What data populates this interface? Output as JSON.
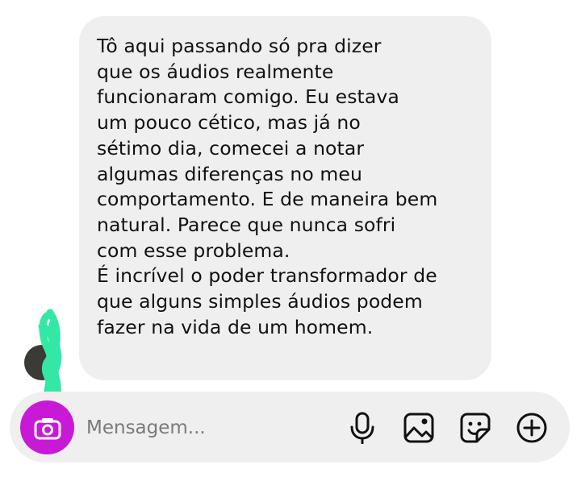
{
  "message": {
    "text": "Tô aqui passando só pra dizer\nque os áudios realmente\nfuncionaram comigo. Eu estava\num pouco cético, mas já no\nsétimo dia, comecei a notar\nalgumas diferenças no meu\ncomportamento. E de maneira bem\nnatural. Parece que nunca sofri\ncom esse problema.\nÉ incrível o poder transformador de\nque alguns simples áudios podem\nfazer na vida de um homem."
  },
  "composer": {
    "placeholder": "Mensagem...",
    "value": ""
  },
  "icons": {
    "camera": "camera-icon",
    "microphone": "microphone-icon",
    "gallery": "gallery-icon",
    "sticker": "sticker-icon",
    "add": "plus-circle-icon"
  },
  "colors": {
    "bubble_background": "#efefef",
    "composer_background": "#efefef",
    "camera_button": "#c81ad6",
    "scribble_overlay": "#33e8a5",
    "text": "#111111",
    "placeholder": "#7a7a7a"
  }
}
